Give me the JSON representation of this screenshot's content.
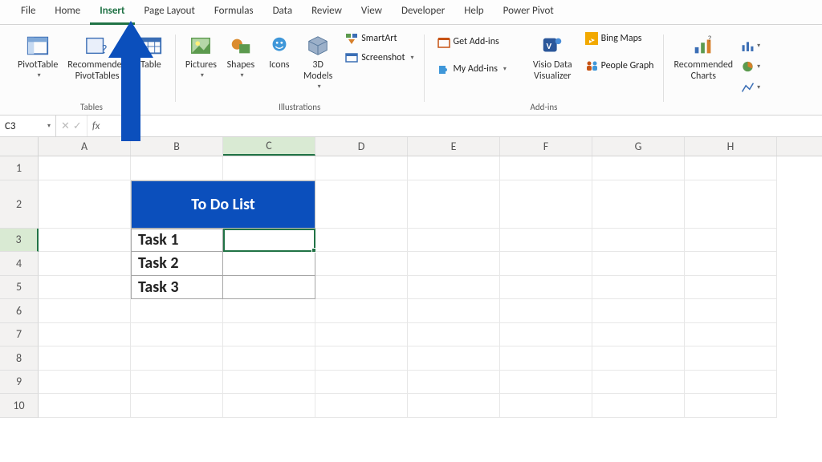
{
  "tabs": [
    "File",
    "Home",
    "Insert",
    "Page Layout",
    "Formulas",
    "Data",
    "Review",
    "View",
    "Developer",
    "Help",
    "Power Pivot"
  ],
  "active_tab_index": 2,
  "ribbon": {
    "tables": {
      "label": "Tables",
      "pivottable": "PivotTable",
      "recommended": "Recommended\nPivotTables",
      "table": "Table"
    },
    "illustrations": {
      "label": "Illustrations",
      "pictures": "Pictures",
      "shapes": "Shapes",
      "icons": "Icons",
      "models": "3D\nModels",
      "smartart": "SmartArt",
      "screenshot": "Screenshot"
    },
    "addins": {
      "label": "Add-ins",
      "getaddins": "Get Add-ins",
      "myaddins": "My Add-ins",
      "visio": "Visio Data\nVisualizer",
      "bingmaps": "Bing Maps",
      "peoplegraph": "People Graph"
    },
    "charts": {
      "recommended": "Recommended\nCharts"
    }
  },
  "namebox": "C3",
  "columns": [
    "A",
    "B",
    "C",
    "D",
    "E",
    "F",
    "G",
    "H"
  ],
  "rows": [
    "1",
    "2",
    "3",
    "4",
    "5",
    "6",
    "7",
    "8",
    "9",
    "10"
  ],
  "selected_col": 2,
  "selected_row": 2,
  "table": {
    "header": "To Do List",
    "tasks": [
      "Task 1",
      "Task 2",
      "Task 3"
    ]
  }
}
